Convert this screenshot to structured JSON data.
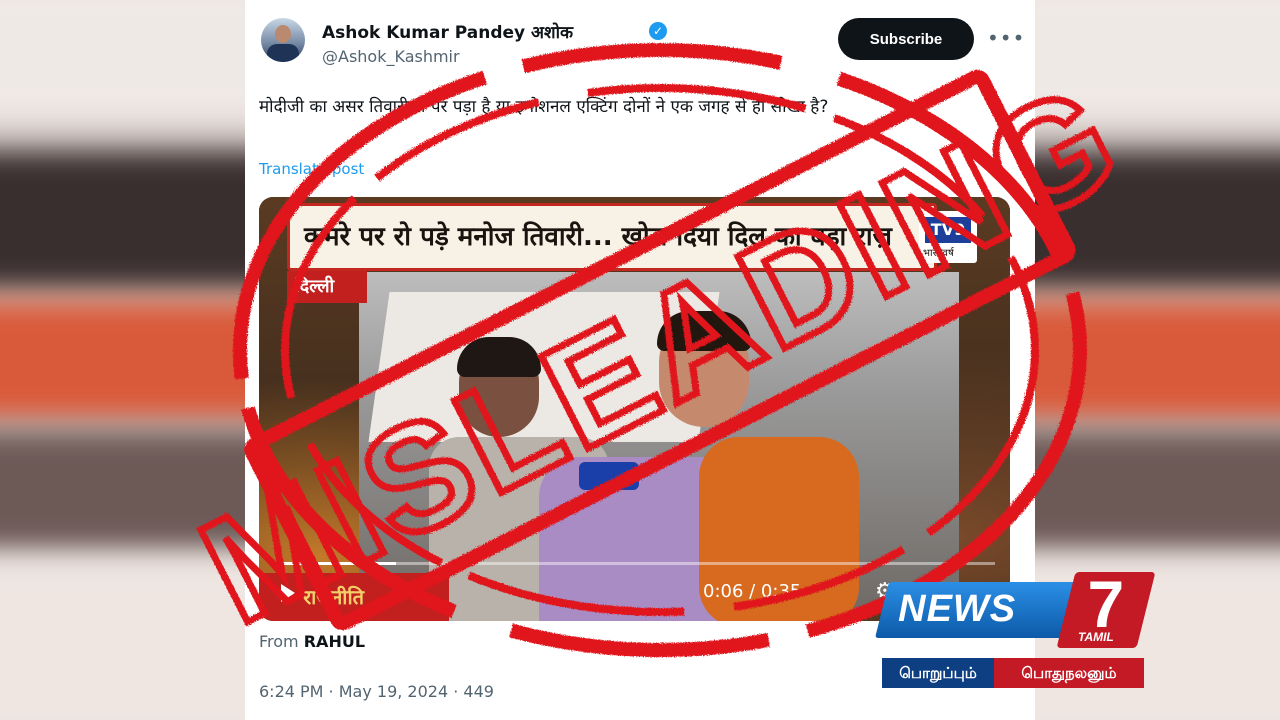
{
  "tweet": {
    "author_name": "Ashok Kumar Pandey अशोक",
    "handle": "@Ashok_Kashmir",
    "subscribe_label": "Subscribe",
    "more_label": "•••",
    "text": "मोदीजी का असर तिवारीजी पर पड़ा है या इमोशनल एक्टिंग दोनों ने एक जगह से ही सीखा है?",
    "translate_label": "Translate post",
    "from_prefix": "From",
    "from_name": "RAHUL",
    "timestamp": "6:24 PM · May 19, 2024 · 449"
  },
  "video": {
    "banner_text": "कमरे पर रो पड़े मनोज तिवारी... खोल दिया दिल का बड़ा राज़",
    "channel_badge": "TV9",
    "channel_sub": "भारतवर्ष",
    "location_tag": "दिल्ली",
    "bottom_tag": "राजनीति",
    "time_display": "0:06 / 0:35",
    "progress": 0.17
  },
  "stamp": {
    "text": "MISLEADING",
    "color": "#e0141c"
  },
  "logo": {
    "brand": "NEWS",
    "number": "7",
    "sub": "TAMIL",
    "tagline_left": "பொறுப்பும்",
    "tagline_right": "பொதுநலனும்"
  },
  "colors": {
    "accent": "#1d9bf0",
    "button_dark": "#0f1419"
  }
}
